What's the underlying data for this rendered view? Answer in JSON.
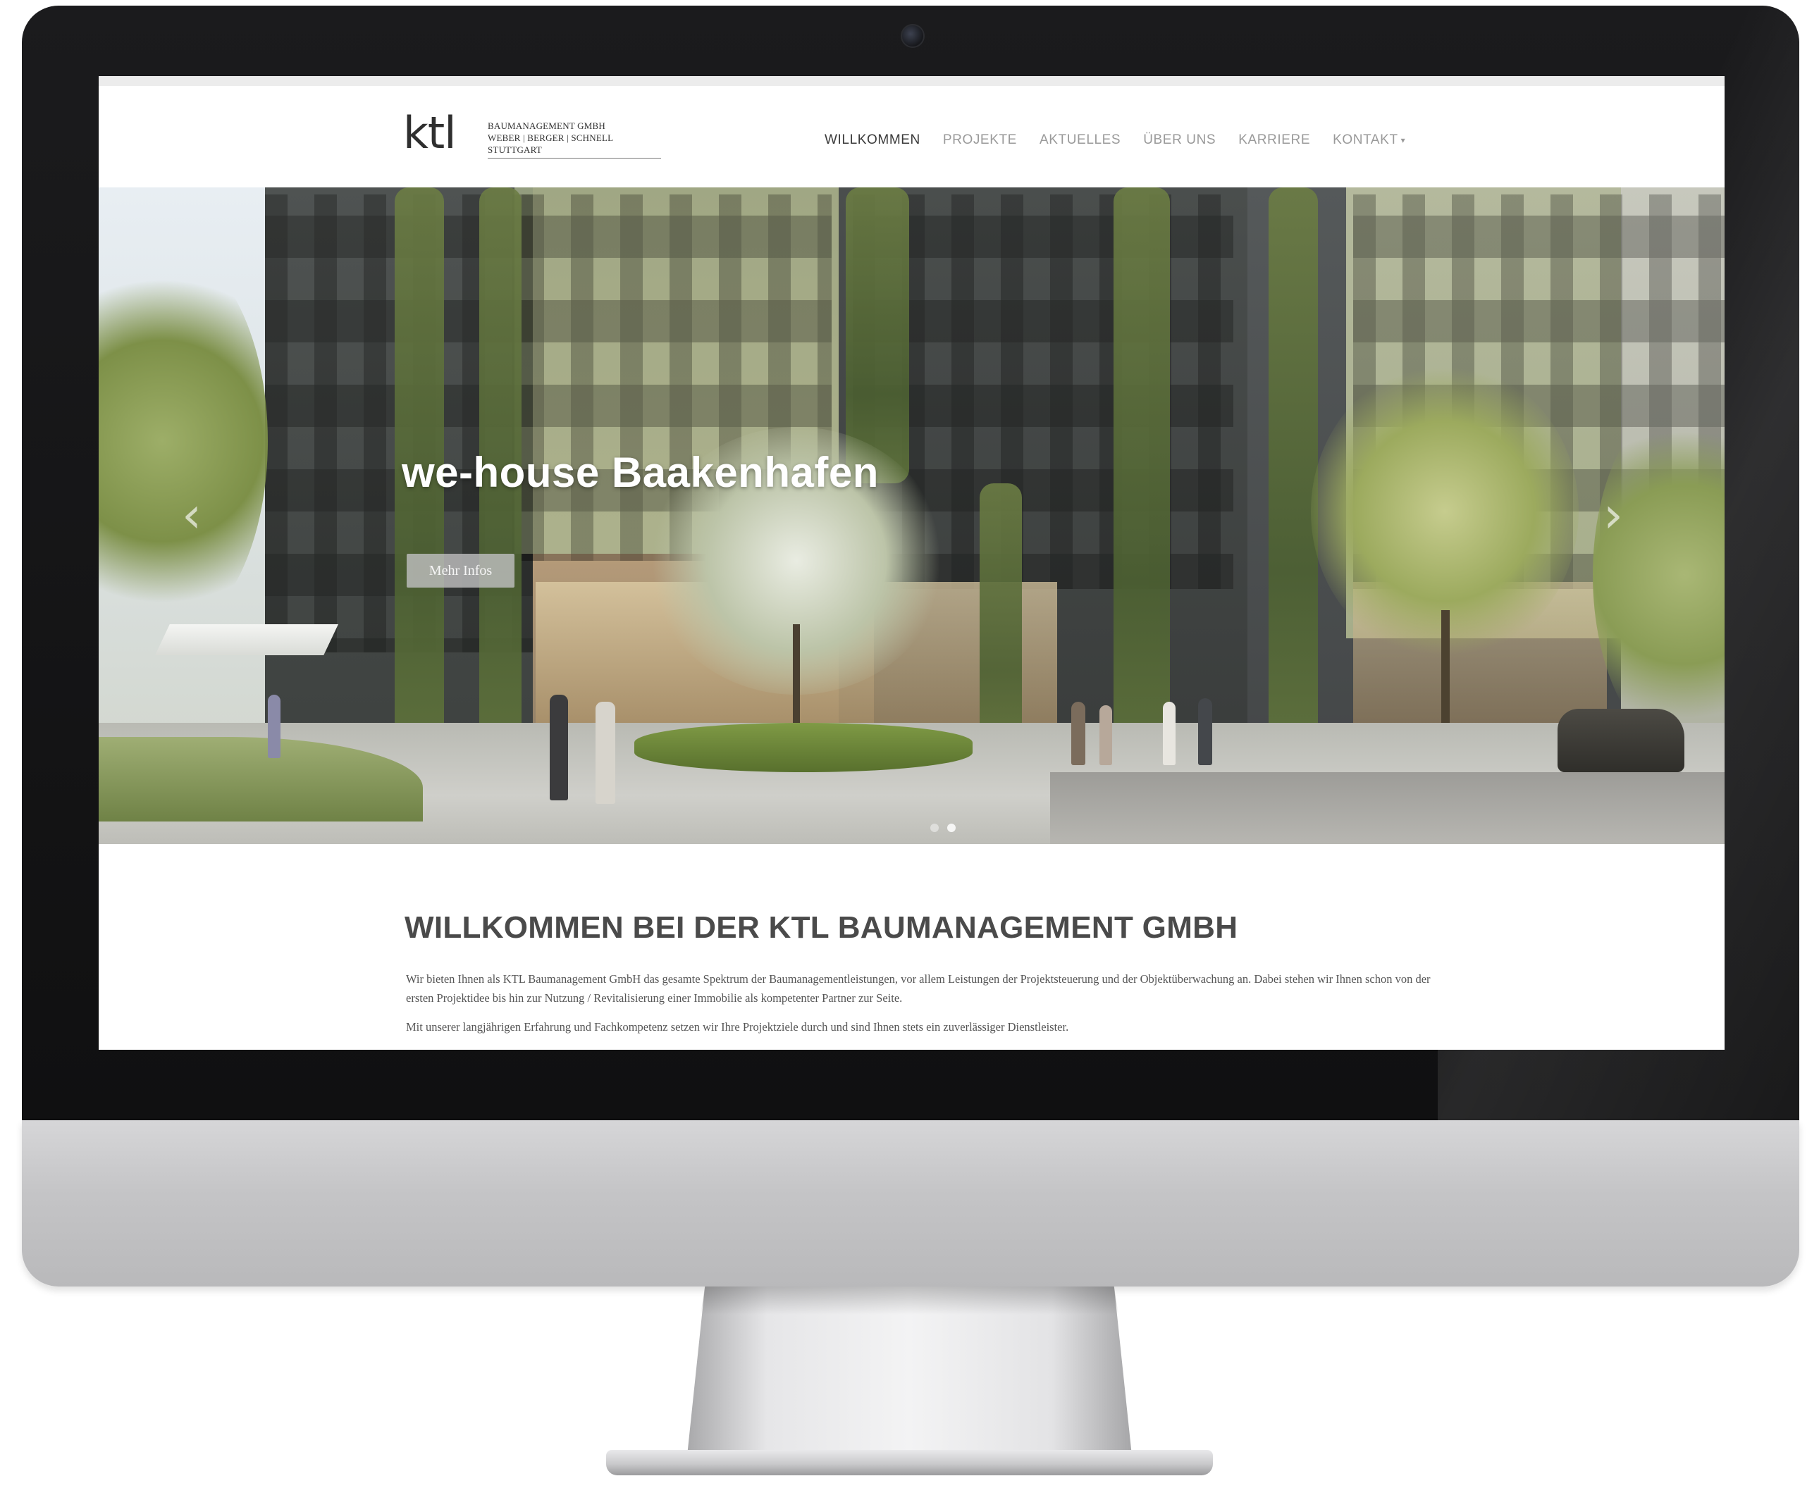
{
  "logo": {
    "mark": "ktl",
    "lines": [
      "BAUMANAGEMENT GMBH",
      "WEBER | BERGER | SCHNELL",
      "STUTTGART"
    ]
  },
  "nav": {
    "items": [
      {
        "label": "WILLKOMMEN",
        "active": true
      },
      {
        "label": "PROJEKTE"
      },
      {
        "label": "AKTUELLES"
      },
      {
        "label": "ÜBER UNS"
      },
      {
        "label": "KARRIERE"
      },
      {
        "label": "KONTAKT"
      }
    ]
  },
  "hero": {
    "title": "we-house Baakenhafen",
    "button": "Mehr Infos",
    "prev_icon": "chevron-left-icon",
    "next_icon": "chevron-right-icon",
    "slides": 2,
    "active_slide": 2
  },
  "content": {
    "title": "WILLKOMMEN BEI DER KTL BAUMANAGEMENT GMBH",
    "paragraph1": "Wir bieten Ihnen als KTL Baumanagement GmbH das gesamte Spektrum der Baumanagementleistungen, vor allem Leistungen der Projektsteuerung und der Objektüberwachung an. Dabei stehen wir Ihnen schon von der ersten Projektidee bis hin zur Nutzung / Revitalisierung einer Immobilie als kompetenter Partner zur Seite.",
    "paragraph2": "Mit unserer langjährigen Erfahrung und Fachkompetenz setzen wir Ihre Projektziele durch und sind Ihnen stets ein zuverlässiger Dienstleister."
  },
  "colors": {
    "bezel": "#141415",
    "nav_active": "#3a3a3a",
    "nav_inactive": "#9a9a9a",
    "heading": "#4a4a4a"
  }
}
